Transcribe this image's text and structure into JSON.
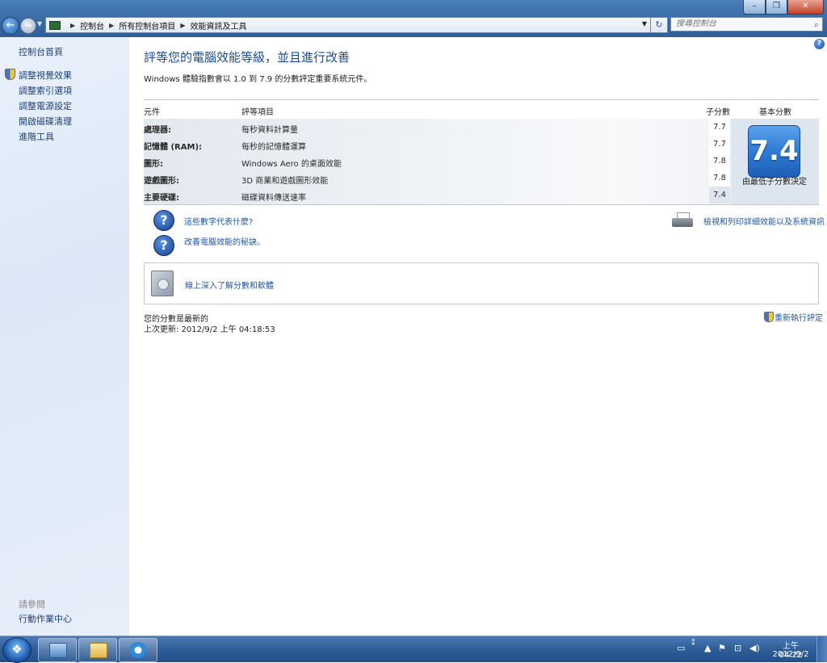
{
  "window": {
    "address": {
      "crumbs": [
        "控制台",
        "所有控制台項目",
        "效能資訊及工具"
      ]
    },
    "search": {
      "placeholder": "搜尋控制台"
    }
  },
  "sidebar": {
    "home": "控制台首頁",
    "links": [
      "調整視覺效果",
      "調整索引選項",
      "調整電源設定",
      "開啟磁碟清理",
      "進階工具"
    ],
    "see_also_title": "請參閱",
    "see_also_links": [
      "行動作業中心"
    ]
  },
  "main": {
    "title": "評等您的電腦效能等級，並且進行改善",
    "description": "Windows 體驗指數會以 1.0 到 7.9 的分數評定重要系統元件。",
    "table": {
      "headers": {
        "component": "元件",
        "rated": "評等項目",
        "subscore": "子分數",
        "base": "基本分數"
      },
      "rows": [
        {
          "component": "處理器:",
          "what": "每秒資料計算量",
          "subscore": "7.7"
        },
        {
          "component": "記憶體 (RAM):",
          "what": "每秒的記憶體運算",
          "subscore": "7.7"
        },
        {
          "component": "圖形:",
          "what": "Windows Aero 的桌面效能",
          "subscore": "7.8"
        },
        {
          "component": "遊戲圖形:",
          "what": "3D 商業和遊戲圖形效能",
          "subscore": "7.8"
        },
        {
          "component": "主要硬碟:",
          "what": "磁碟資料傳送速率",
          "subscore": "7.4"
        }
      ],
      "base_score": "7.4",
      "base_caption": "由最低子分數決定"
    },
    "links": {
      "what_mean": "這些數字代表什麼?",
      "tips": "改善電腦效能的秘訣。",
      "print": "檢視和列印詳細效能以及系統資訊",
      "online": "線上深入了解分數和軟體"
    },
    "status": {
      "current": "您的分數是最新的",
      "last_update": "上次更新: 2012/9/2 上午 04:18:53"
    },
    "rerun": "重新執行評定"
  },
  "taskbar": {
    "clock_time": "上午 04:22",
    "clock_date": "2012/9/2"
  },
  "colors": {
    "link": "#1f56a8",
    "title": "#1f4c8f",
    "taskbar": "#2e5d98",
    "score_tile": "#2f7bd4"
  }
}
